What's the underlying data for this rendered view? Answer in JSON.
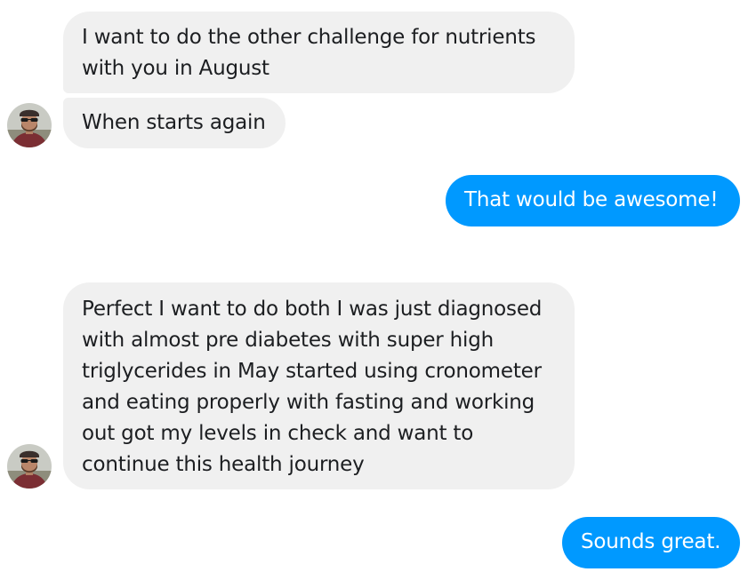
{
  "conversation": {
    "messages": [
      {
        "sender": "contact",
        "text": "I want to do the other challenge for nutrients with you in August"
      },
      {
        "sender": "contact",
        "text": "When starts again"
      },
      {
        "sender": "me",
        "text": "That would be awesome!"
      },
      {
        "sender": "contact",
        "text": "Perfect I want to do both I was just diagnosed with almost pre diabetes with super high triglycerides in May started using cronometer and eating properly with fasting and working out got my levels in check and want to continue this health journey"
      },
      {
        "sender": "me",
        "text": "Sounds great."
      }
    ]
  },
  "colors": {
    "incoming_bubble": "#f0f0f0",
    "outgoing_bubble": "#0099ff",
    "incoming_text": "#1c1e21",
    "outgoing_text": "#ffffff"
  },
  "icons": {
    "avatar": "contact-avatar-photo"
  }
}
